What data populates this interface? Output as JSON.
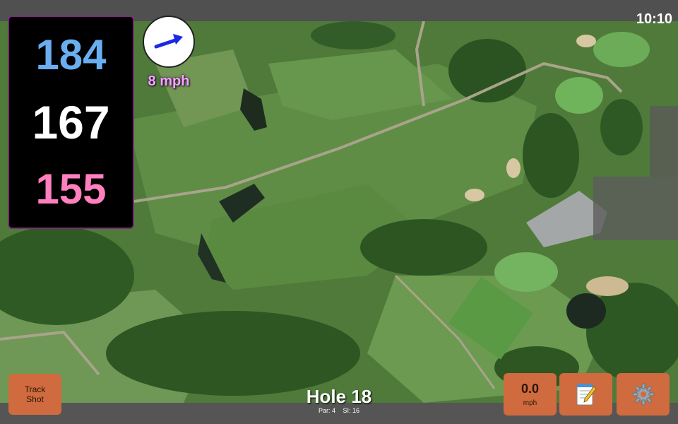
{
  "status": {
    "time": "10:10"
  },
  "distances": {
    "back": "184",
    "middle": "167",
    "front": "155"
  },
  "wind": {
    "speed_label": "8 mph",
    "direction_icon": "arrow-up-right-icon",
    "arrow_color": "#1a28e6"
  },
  "buttons": {
    "track_shot_line1": "Track",
    "track_shot_line2": "Shot",
    "speed_value": "0.0",
    "speed_unit": "mph",
    "notes_icon": "notepad-icon",
    "settings_icon": "gear-icon"
  },
  "hole": {
    "title": "Hole 18",
    "par": "Par: 4",
    "si": "SI: 16"
  },
  "colors": {
    "button_bg": "#cf6b3e",
    "back_distance": "#6aaef2",
    "middle_distance": "#ffffff",
    "front_distance": "#ff7fbf",
    "wind_label": "#f2a4ff"
  }
}
